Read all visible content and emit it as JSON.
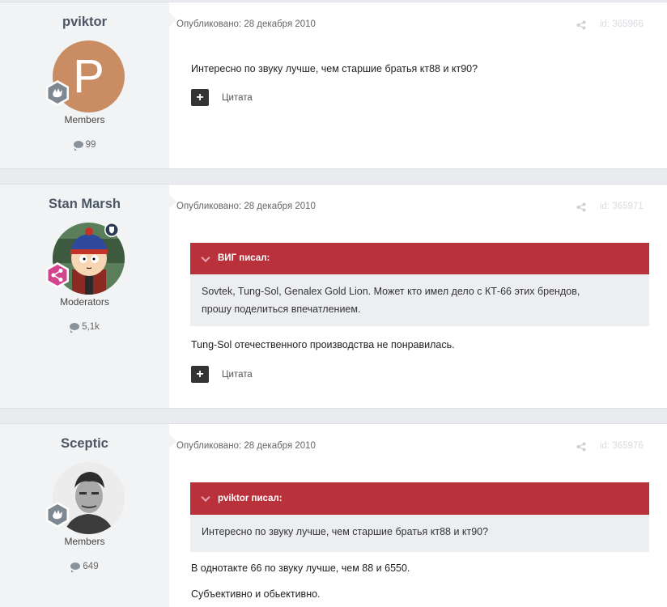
{
  "posts": [
    {
      "author": "pviktor",
      "avatar_letter": "P",
      "group": "Members",
      "post_count": "99",
      "date": "Опубликовано: 28 декабря 2010",
      "id": "id: 365966",
      "text": [
        "Интересно по звуку лучше, чем старшие братья кт88 и кт90?"
      ],
      "quote_button": "Цитата"
    },
    {
      "author": "Stan Marsh",
      "group": "Moderators",
      "post_count": "5,1k",
      "date": "Опубликовано: 28 декабря 2010",
      "id": "id: 365971",
      "quote": {
        "header": "ВИГ писал:",
        "lines": [
          "Sovtek, Tung-Sol, Genalex Gold Lion. Может кто имел дело с КТ-66 этих брендов,",
          "прошу поделиться впечатлением."
        ]
      },
      "text": [
        "Tung-Sol отечественного производства не понравилась."
      ],
      "quote_button": "Цитата"
    },
    {
      "author": "Sceptic",
      "group": "Members",
      "post_count": "649",
      "date": "Опубликовано: 28 декабря 2010",
      "id": "id: 365976",
      "quote": {
        "header": "pviktor писал:",
        "lines": [
          "Интересно по звуку лучше, чем старшие братья кт88 и кт90?"
        ]
      },
      "text": [
        "В однотакте 66 по звуку лучше, чем 88 и 6550.",
        "Субъективно и обьективно."
      ]
    }
  ],
  "icons": {
    "share": "share-icon",
    "post_count": "comment-icon",
    "quote_toggle": "chevron-down-icon",
    "rank": "hand-badge-icon",
    "moderator_rank": "share-badge-icon",
    "moderator_flag": "shield-icon",
    "multiquote": "plus-icon"
  },
  "colors": {
    "quote_header": "#b8313b",
    "quote_body": "#eceef2",
    "author_panel": "#f2f3f5",
    "moderator_badge": "#d2448c"
  }
}
